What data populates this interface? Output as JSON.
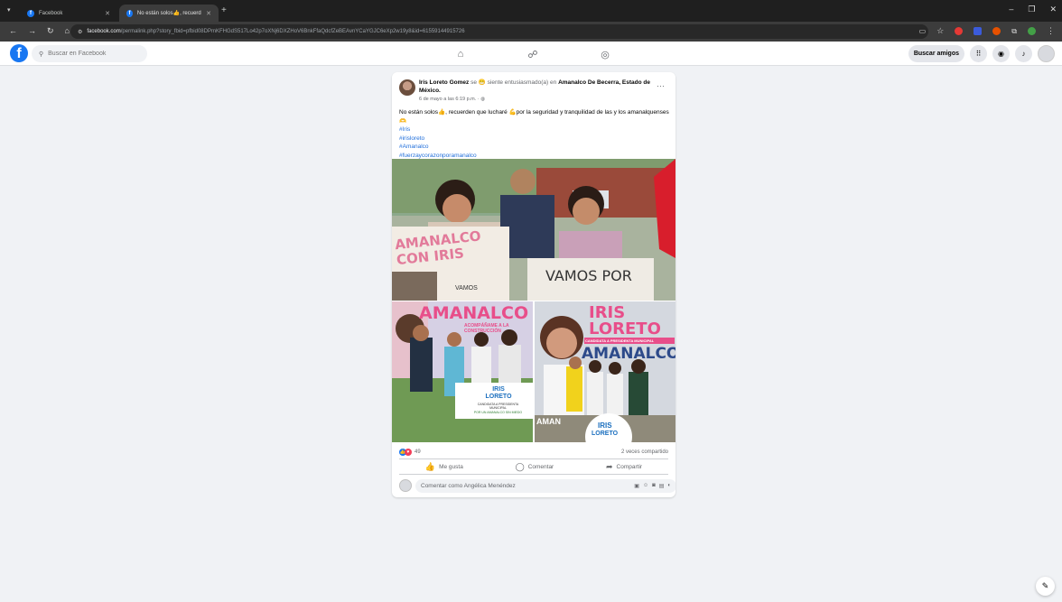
{
  "browser": {
    "tabs": [
      {
        "label": "Facebook"
      },
      {
        "label": "No están solos👍, recuerden q"
      }
    ],
    "url_domain": "facebook.com",
    "url_path": "/permalink.php?story_fbid=pfbid08DPmKFHGdS517Lo42p7oXNj6DXZHoV6BnkFfaQdcfZeBEAvnYCaYGJC6eXp2w19y8&id=61559144915726"
  },
  "facebook": {
    "search_placeholder": "Buscar en Facebook",
    "find_friends_label": "Buscar amigos"
  },
  "post": {
    "author": "Iris Loreto Gomez",
    "feeling_text": "se 😁 siente entusiasmado(a) en",
    "location": "Amanalco De Becerra, Estado de México.",
    "date": "6 de mayo a las 6:19 p.m. ·",
    "body": "No están solos👍, recuerden que lucharé 💪por la seguridad y tranquilidad de las y los amanalquenses🫶",
    "hashtags": [
      "#Iris",
      "#irisloreto",
      "#Amanalco",
      "#fuerzaycorazonporamanalco"
    ],
    "photo_texts": {
      "sign_left": "AMANALCO CON IRIS",
      "sign_left_small": "VAMOS",
      "sign_right": "VAMOS POR",
      "poster_left_title": "AMANALCO",
      "poster_left_sub": "ACOMPÁÑAME A LA CONSTRUCCIÓN",
      "poster_left_card_name": "IRIS LORETO",
      "poster_left_card_sub": "CANDIDATA A PRESIDENTA MUNICIPAL",
      "poster_left_card_sub2": "POR UN AMANALCO SIN MIEDO",
      "poster_right_name1": "IRIS",
      "poster_right_name2": "LORETO",
      "poster_right_role": "CANDIDATA A PRESIDENTA MUNICIPAL",
      "poster_right_town": "AMANALCO",
      "poster_right_badge1": "IRIS",
      "poster_right_badge2": "LORETO",
      "poster_right_bottom": "AMAN"
    },
    "reactions_count": "49",
    "shares": "2 veces compartido",
    "actions": {
      "like": "Me gusta",
      "comment": "Comentar",
      "share": "Compartir"
    },
    "comment_placeholder": "Comentar como Angélica Menéndez"
  },
  "colors": {
    "fb_blue": "#1877f2",
    "hashtag": "#216fdb",
    "page_bg": "#f0f2f5"
  }
}
